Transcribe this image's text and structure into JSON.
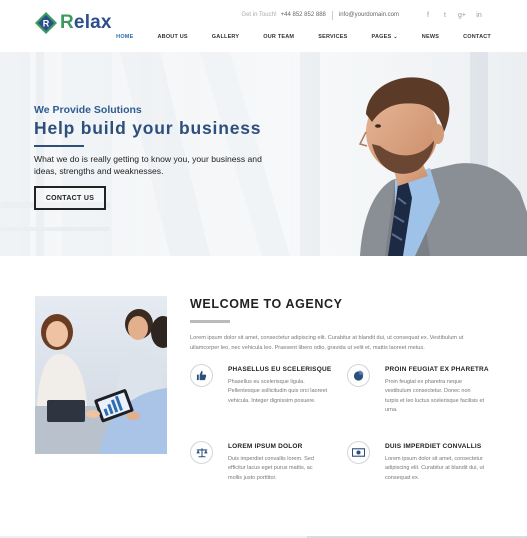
{
  "brand": {
    "logo_letter": "R",
    "name_first": "R",
    "name_rest": "elax",
    "color_primary": "#2b4f8a",
    "color_accent": "#3c9a5f"
  },
  "topbar": {
    "get_in_touch": "Get in Touch!",
    "phone": "+44 852 852 888",
    "email": "info@yourdomain.com",
    "social": [
      {
        "icon": "facebook-icon",
        "glyph": "f"
      },
      {
        "icon": "twitter-icon",
        "glyph": "t"
      },
      {
        "icon": "google-plus-icon",
        "glyph": "g+"
      },
      {
        "icon": "linkedin-icon",
        "glyph": "in"
      }
    ]
  },
  "nav": {
    "items": [
      {
        "label": "HOME",
        "active": true
      },
      {
        "label": "ABOUT US"
      },
      {
        "label": "GALLERY"
      },
      {
        "label": "OUR TEAM"
      },
      {
        "label": "SERVICES"
      },
      {
        "label": "PAGES",
        "caret": "⌄"
      },
      {
        "label": "NEWS"
      },
      {
        "label": "CONTACT"
      }
    ],
    "active_color": "#2f6cb1"
  },
  "hero": {
    "subtitle": "We Provide Solutions",
    "title": "Help build your business",
    "description": "What we do is really getting to know you, your business and ideas, strengths and weaknesses.",
    "button": "CONTACT US"
  },
  "welcome": {
    "title": "WELCOME TO AGENCY",
    "description": "Lorem ipsum dolor sit amet, consectetur adipiscing elit. Curabitur at blandit dui, ut consequat ex. Vestibulum ut ullamcorper leo, nec vehicula leo. Praesent libero odio, gravida ut velit et, mattis laoreet metus.",
    "features": [
      {
        "icon": "thumbs-up-icon",
        "title": "PHASELLUS EU SCELERISQUE",
        "text": "Phasellus eu scelerisque ligula. Pellentesque sollicitudin quis orci laoreet vehicula. Integer dignissim posuere."
      },
      {
        "icon": "pie-chart-icon",
        "title": "PROIN FEUGIAT EX PHARETRA",
        "text": "Proin feugiat ex pharetra neque vestibulum consectetur. Donec non turpis et leo luctus scelerisque facilisis et urna."
      },
      {
        "icon": "balance-scale-icon",
        "title": "LOREM IPSUM DOLOR",
        "text": "Duis imperdiet convallis lorem. Sed efficitur lacus eget purus mattis, ac mollis justo porttitor."
      },
      {
        "icon": "money-icon",
        "title": "DUIS IMPERDIET CONVALLIS",
        "text": "Lorem ipsum dolor sit amet, consectetur adipiscing elit. Curabitur at blandit dui, ut consequat ex."
      }
    ]
  }
}
